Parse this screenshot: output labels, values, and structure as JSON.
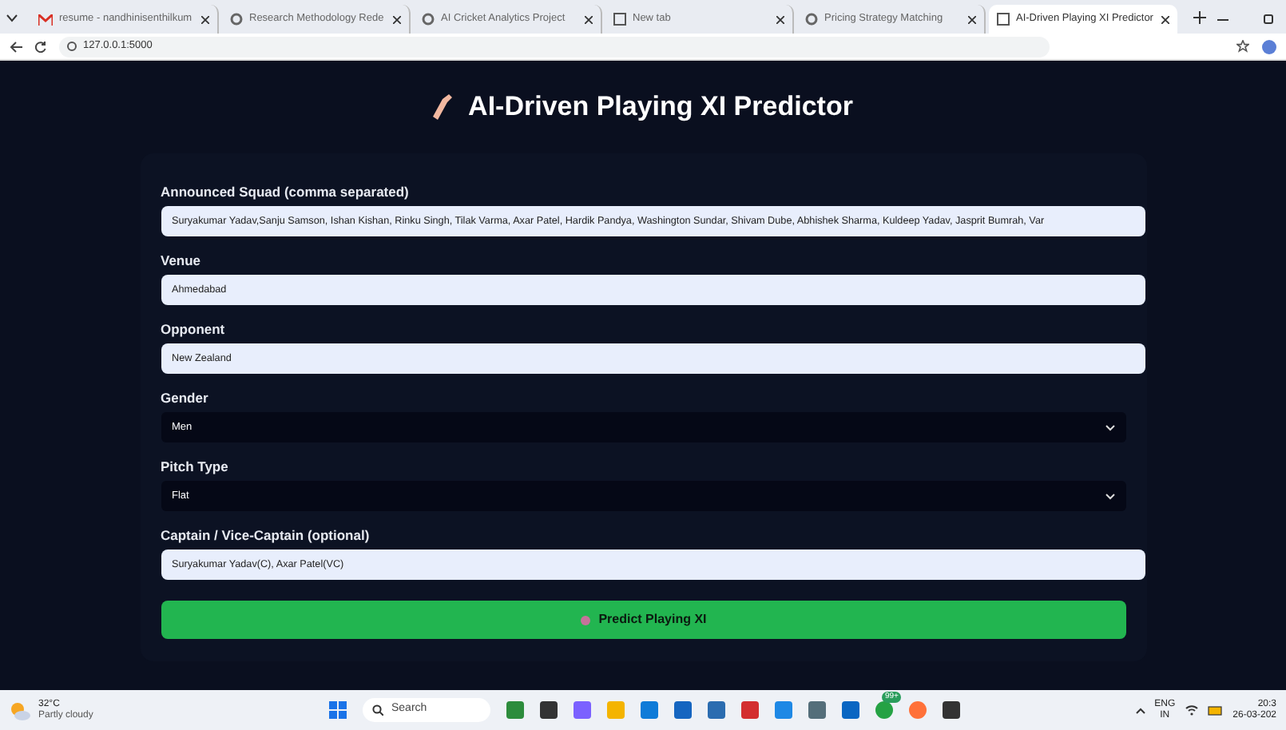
{
  "browser": {
    "tabs": [
      {
        "label": "resume - nandhinisenthilkum",
        "selected": false,
        "kind": "mail"
      },
      {
        "label": "Research Methodology Rede",
        "selected": false,
        "kind": "site"
      },
      {
        "label": "AI Cricket Analytics Project",
        "selected": false,
        "kind": "site"
      },
      {
        "label": "New tab",
        "selected": false,
        "kind": "page"
      },
      {
        "label": "Pricing Strategy Matching",
        "selected": false,
        "kind": "site"
      },
      {
        "label": "AI-Driven Playing XI Predictor",
        "selected": true,
        "kind": "page"
      }
    ],
    "address": "127.0.0.1:5000"
  },
  "page": {
    "title": "AI-Driven Playing XI Predictor",
    "fields": [
      {
        "kind": "text",
        "label": "Announced Squad (comma separated)",
        "value": "Suryakumar Yadav,Sanju Samson, Ishan Kishan, Rinku Singh, Tilak Varma, Axar Patel, Hardik Pandya, Washington Sundar, Shivam Dube, Abhishek Sharma, Kuldeep Yadav, Jasprit Bumrah, Var"
      },
      {
        "kind": "text",
        "label": "Venue",
        "value": "Ahmedabad"
      },
      {
        "kind": "text",
        "label": "Opponent",
        "value": "New Zealand"
      },
      {
        "kind": "select",
        "label": "Gender",
        "value": "Men"
      },
      {
        "kind": "select",
        "label": "Pitch Type",
        "value": "Flat"
      },
      {
        "kind": "text",
        "label": "Captain / Vice-Captain (optional)",
        "value": "Suryakumar Yadav(C), Axar Patel(VC)"
      }
    ],
    "submit": "Predict Playing XI"
  },
  "taskbar": {
    "weather_temp": "32°C",
    "weather_text": "Partly cloudy",
    "search": "Search",
    "badge": "99+",
    "lang": "ENG",
    "region": "IN",
    "time": "20:3",
    "date": "26-03-202"
  }
}
